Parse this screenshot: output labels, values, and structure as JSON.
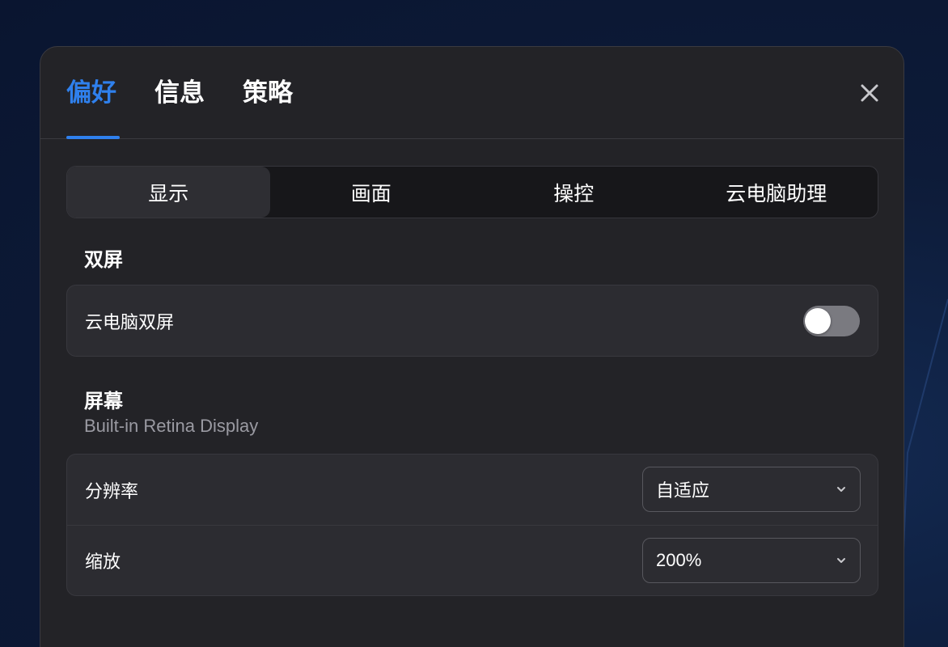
{
  "colors": {
    "accent": "#2f80ed",
    "panel_bg": "#232327",
    "card_bg": "#2c2c31",
    "toggle_off": "#7a7a80"
  },
  "header": {
    "tabs": [
      {
        "label": "偏好",
        "active": true
      },
      {
        "label": "信息",
        "active": false
      },
      {
        "label": "策略",
        "active": false
      }
    ],
    "close_icon": "close-icon"
  },
  "subtabs": [
    {
      "label": "显示",
      "active": true
    },
    {
      "label": "画面",
      "active": false
    },
    {
      "label": "操控",
      "active": false
    },
    {
      "label": "云电脑助理",
      "active": false
    }
  ],
  "dual_screen": {
    "title": "双屏",
    "rows": [
      {
        "label": "云电脑双屏",
        "toggle_on": false
      }
    ]
  },
  "screen": {
    "title": "屏幕",
    "subtitle": "Built-in Retina Display",
    "rows": [
      {
        "label": "分辨率",
        "value": "自适应",
        "icon": "chevron-down-icon"
      },
      {
        "label": "缩放",
        "value": "200%",
        "icon": "chevron-down-icon"
      }
    ]
  }
}
